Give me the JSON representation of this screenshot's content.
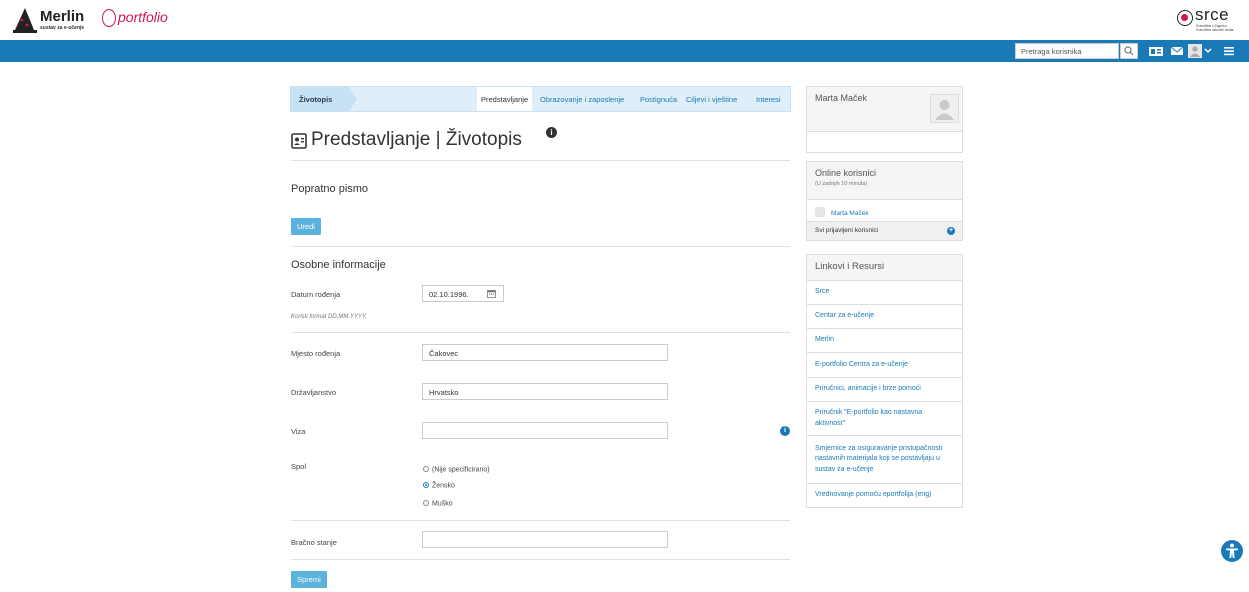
{
  "header": {
    "merlin_logo": "Merlin",
    "merlin_sub": "sustav za e-učenje",
    "portfolio_logo": "portfolio",
    "srce_logo": "srce",
    "srce_sub": "Sveučilište u Zagrebu Sveučilišni računski centar",
    "search_placeholder": "Pretraga korisnika"
  },
  "tabs": {
    "breadcrumb": "Životopis",
    "items": [
      {
        "label": "Predstavljanje",
        "active": true
      },
      {
        "label": "Obrazovanje i zaposlenje"
      },
      {
        "label": "Postignuća"
      },
      {
        "label": "Ciljevi i vještine"
      },
      {
        "label": "Interesi"
      }
    ]
  },
  "page": {
    "title": "Predstavljanje | Životopis",
    "cover_letter_title": "Popratno pismo",
    "edit_button": "Uredi",
    "personal_title": "Osobne informacije",
    "save_button": "Spremi"
  },
  "form": {
    "dob_label": "Datum rođenja",
    "dob_value": "02.10.1996.",
    "dob_hint": "Koristi format DD.MM.YYYY.",
    "pob_label": "Mjesto rođenja",
    "pob_value": "Čakovec",
    "citizenship_label": "Državljanstvo",
    "citizenship_value": "Hrvatsko",
    "visa_label": "Viza",
    "visa_value": "",
    "gender_label": "Spol",
    "gender_options": [
      "(Nije specificirano)",
      "Žensko",
      "Muško"
    ],
    "gender_selected": "Žensko",
    "marital_label": "Bračno stanje",
    "marital_value": ""
  },
  "sidebar": {
    "user_name": "Marta Maček",
    "online_title": "Online korisnici",
    "online_sub": "(U zadnjih 10 minuta)",
    "online_user": "Marta Maček",
    "online_all": "Svi prijavljeni korisnici",
    "links_title": "Linkovi i Resursi",
    "links": [
      "Srce",
      "Centar za e-učenje",
      "Merlin",
      "E-portfolio Centra za e-učenje",
      "Priručnici, animacije i brze pomoći",
      "Priručnik \"E-portfolio kao nastavna aktivnost\"",
      "Smjernice za osiguravanje pristupačnosti nastavnih materijala koji se postavljaju u sustav za e-učenje",
      "Vrednovanje pomoću eportfolija (eng)"
    ]
  },
  "colors": {
    "accent": "#1a7ab8",
    "button": "#5bb2dd",
    "brand_pink": "#d4145a"
  }
}
